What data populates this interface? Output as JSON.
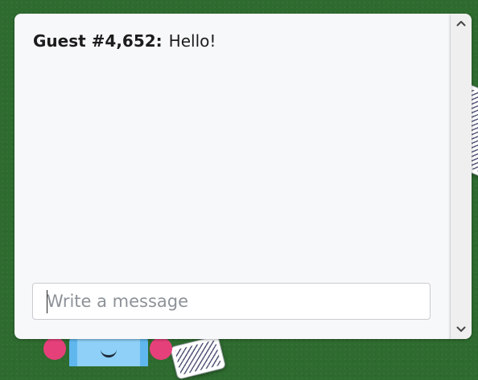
{
  "chat": {
    "messages": [
      {
        "sender": "Guest #4,652:",
        "text": "Hello!"
      }
    ],
    "input": {
      "value": "",
      "placeholder": "Write a message"
    }
  },
  "scrollbar": {
    "up_icon": "chevron-up-icon",
    "down_icon": "chevron-down-icon"
  },
  "colors": {
    "background_felt": "#2e6b2f",
    "panel": "#f7f8f9",
    "scrollbar_track": "#efefef",
    "avatar_ears": "#e6407a",
    "avatar_head": "#5fb7ee"
  }
}
